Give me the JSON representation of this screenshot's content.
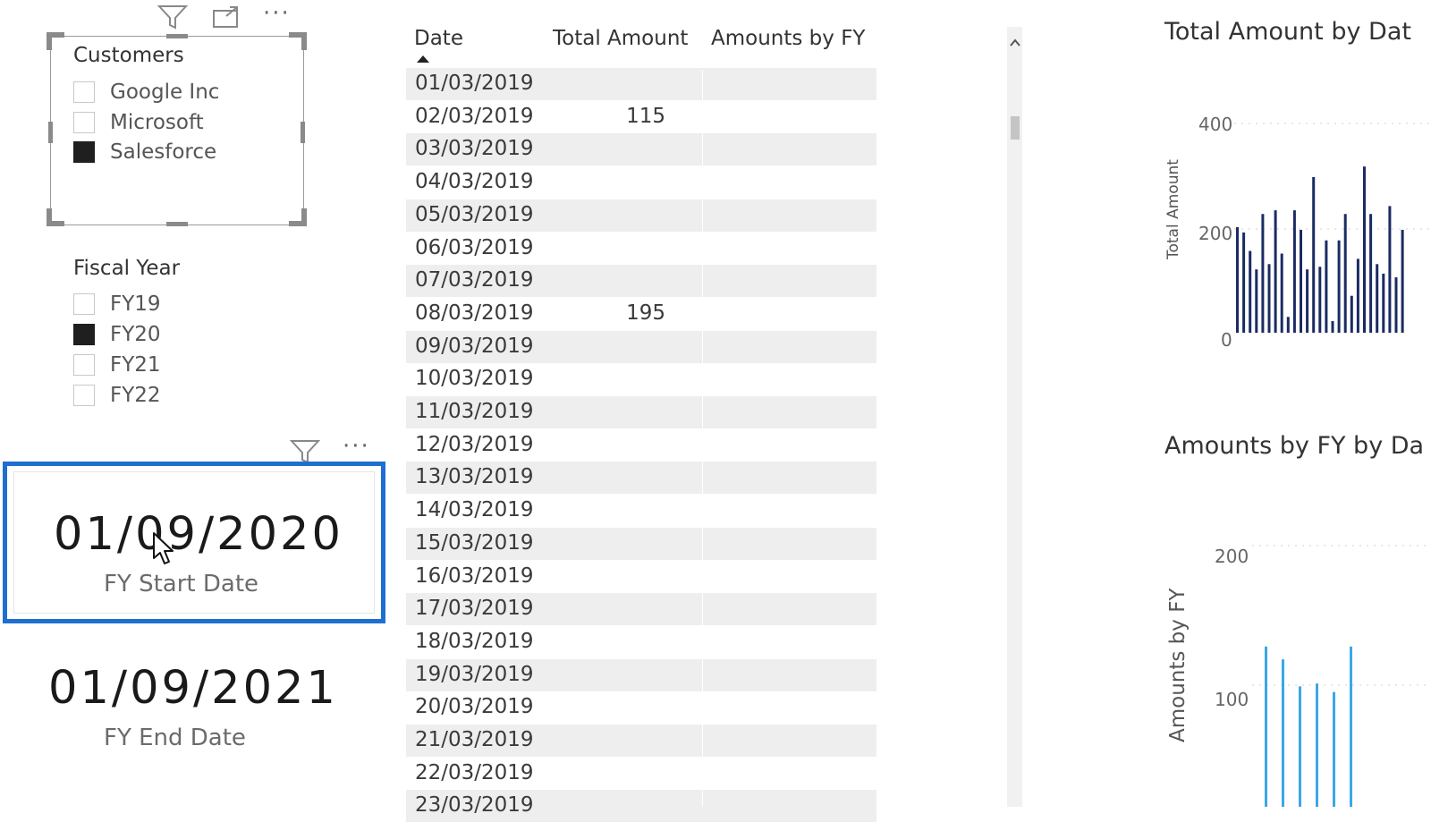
{
  "customers_slicer": {
    "title": "Customers",
    "items": [
      {
        "label": "Google Inc",
        "checked": false
      },
      {
        "label": "Microsoft",
        "checked": false
      },
      {
        "label": "Salesforce",
        "checked": true
      }
    ]
  },
  "fiscal_year_slicer": {
    "title": "Fiscal Year",
    "items": [
      {
        "label": "FY19",
        "checked": false
      },
      {
        "label": "FY20",
        "checked": true
      },
      {
        "label": "FY21",
        "checked": false
      },
      {
        "label": "FY22",
        "checked": false
      }
    ]
  },
  "cards": {
    "start": {
      "value": "01/09/2020",
      "label": "FY Start Date"
    },
    "end": {
      "value": "01/09/2021",
      "label": "FY End Date"
    }
  },
  "table": {
    "columns": [
      "Date",
      "Total Amount",
      "Amounts by FY"
    ],
    "rows": [
      {
        "date": "01/03/2019",
        "total": "",
        "fy": ""
      },
      {
        "date": "02/03/2019",
        "total": "115",
        "fy": ""
      },
      {
        "date": "03/03/2019",
        "total": "",
        "fy": ""
      },
      {
        "date": "04/03/2019",
        "total": "",
        "fy": ""
      },
      {
        "date": "05/03/2019",
        "total": "",
        "fy": ""
      },
      {
        "date": "06/03/2019",
        "total": "",
        "fy": ""
      },
      {
        "date": "07/03/2019",
        "total": "",
        "fy": ""
      },
      {
        "date": "08/03/2019",
        "total": "195",
        "fy": ""
      },
      {
        "date": "09/03/2019",
        "total": "",
        "fy": ""
      },
      {
        "date": "10/03/2019",
        "total": "",
        "fy": ""
      },
      {
        "date": "11/03/2019",
        "total": "",
        "fy": ""
      },
      {
        "date": "12/03/2019",
        "total": "",
        "fy": ""
      },
      {
        "date": "13/03/2019",
        "total": "",
        "fy": ""
      },
      {
        "date": "14/03/2019",
        "total": "",
        "fy": ""
      },
      {
        "date": "15/03/2019",
        "total": "",
        "fy": ""
      },
      {
        "date": "16/03/2019",
        "total": "",
        "fy": ""
      },
      {
        "date": "17/03/2019",
        "total": "",
        "fy": ""
      },
      {
        "date": "18/03/2019",
        "total": "",
        "fy": ""
      },
      {
        "date": "19/03/2019",
        "total": "",
        "fy": ""
      },
      {
        "date": "20/03/2019",
        "total": "",
        "fy": ""
      },
      {
        "date": "21/03/2019",
        "total": "",
        "fy": ""
      },
      {
        "date": "22/03/2019",
        "total": "",
        "fy": ""
      },
      {
        "date": "23/03/2019",
        "total": "",
        "fy": ""
      }
    ]
  },
  "chart_data": [
    {
      "type": "bar",
      "title": "Total Amount by Dat",
      "ylabel": "Total Amount",
      "yticks": [
        "400",
        "200",
        "0"
      ],
      "ylim": [
        0,
        400
      ],
      "color": "#1b2b63",
      "values": [
        200,
        190,
        155,
        120,
        225,
        130,
        232,
        150,
        30,
        232,
        195,
        120,
        295,
        125,
        175,
        22,
        175,
        225,
        70,
        140,
        315,
        225,
        130,
        112,
        240,
        105,
        195
      ]
    },
    {
      "type": "bar",
      "title": "Amounts by FY by Da",
      "ylabel": "Amounts by FY",
      "yticks": [
        "200",
        "100"
      ],
      "ylim": [
        0,
        200
      ],
      "color": "#3aa7e8",
      "values": [
        124,
        115,
        96,
        98,
        92,
        124
      ]
    }
  ],
  "colors": {
    "selection": "#1f6fd0",
    "grid_alt": "#eeeeee",
    "header_line": "#7fa7e6"
  }
}
